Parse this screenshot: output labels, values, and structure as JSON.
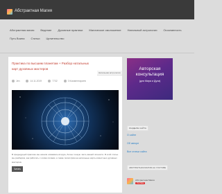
{
  "header": {
    "site_title": "Абстрактная Магия"
  },
  "nav": {
    "row1": [
      "Абстрактная магия",
      "Ведение",
      "Духовные практики",
      "Магическое омоложение",
      "Натальный астрологии",
      "Осознанность"
    ],
    "row2": [
      "Путь Воина",
      "Статьи",
      "Целительство"
    ]
  },
  "post": {
    "title": "Практика по высшим планетам + Разбор натальных карт духовных мастеров",
    "category": "Натальная астрология",
    "author": "Jen",
    "date": "14.11.2019",
    "views": "7732",
    "comments": "0 Комментариев",
    "excerpt": "В предыдущей практике мы начали осваивать вторую, более тонкую часть вашей личности. В этой статье мы разберём, как работать с этими силами, а также посмотрим на натальные карты известных духовных мастеров.",
    "read_more": "Читать"
  },
  "sidebar": {
    "promo": {
      "line1": "Авторская",
      "line2": "консультация",
      "line3": "(для Мира и Духа)"
    },
    "section1_title": "РАЗДЕЛЫ САЙТА",
    "links": [
      "О сайте",
      "Об авторе",
      "Все статьи сайта"
    ],
    "section2_title": "АБСТРАКТНАЯ МАГИЯ НА YOUTUBE",
    "follow": {
      "name": "Абстрактная Магия",
      "button": "YouTube"
    }
  },
  "colors": {
    "topbar": "#3a3a3a",
    "title_red": "#c0392b",
    "link_blue": "#2a80c7",
    "promo_purple": "#5d2a8a"
  }
}
